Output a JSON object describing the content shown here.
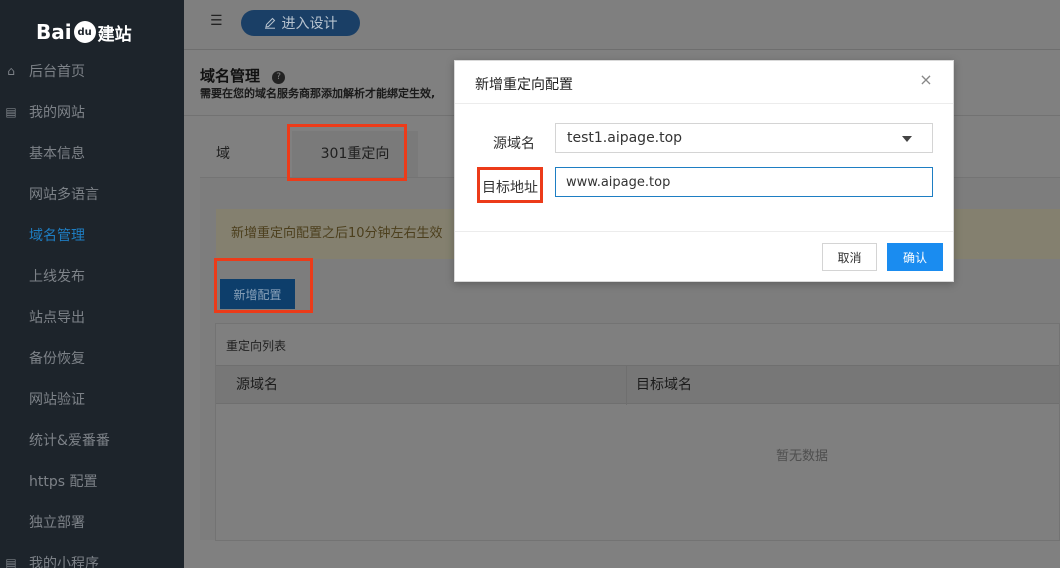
{
  "brand": {
    "logo_text_latin": "Bai",
    "logo_paw": "du",
    "logo_text_cn": "建站"
  },
  "sidebar": {
    "items": [
      {
        "label": "后台首页",
        "icon": "home-icon",
        "glyph": "⌂",
        "active": false
      },
      {
        "label": "我的网站",
        "icon": "document-icon",
        "glyph": "▤",
        "active": false
      },
      {
        "label": "基本信息",
        "active": false
      },
      {
        "label": "网站多语言",
        "active": false
      },
      {
        "label": "域名管理",
        "active": true
      },
      {
        "label": "上线发布",
        "active": false
      },
      {
        "label": "站点导出",
        "active": false
      },
      {
        "label": "备份恢复",
        "active": false
      },
      {
        "label": "网站验证",
        "active": false
      },
      {
        "label": "统计&爱番番",
        "active": false
      },
      {
        "label": "https 配置",
        "active": false
      },
      {
        "label": "独立部署",
        "active": false
      },
      {
        "label": "我的小程序",
        "icon": "document-icon",
        "glyph": "▤",
        "active": false
      }
    ]
  },
  "header": {
    "menu_toggle_glyph": "☰",
    "design_button_label": "进入设计",
    "design_button_icon": "edit-icon"
  },
  "page": {
    "title": "域名管理",
    "subtitle": "需要在您的域名服务商那添加解析才能绑定生效,",
    "tabs": [
      {
        "label": "域名列表"
      },
      {
        "label": "301重定向"
      }
    ],
    "notice": "新增重定向配置之后10分钟左右生效",
    "add_button": "新增配置",
    "list": {
      "title": "重定向列表",
      "columns": [
        "源域名",
        "目标域名"
      ],
      "empty_text": "暂无数据"
    }
  },
  "modal": {
    "title": "新增重定向配置",
    "close_glyph": "×",
    "source_label": "源域名",
    "source_value": "test1.aipage.top",
    "target_label": "目标地址",
    "target_value": "www.aipage.top",
    "cancel_label": "取消",
    "ok_label": "确认"
  },
  "colors": {
    "sidebar_bg": "#1d242b",
    "accent": "#1e7ec3",
    "primary_button": "#1a8cf0",
    "annotation_red": "#ec3b19"
  }
}
